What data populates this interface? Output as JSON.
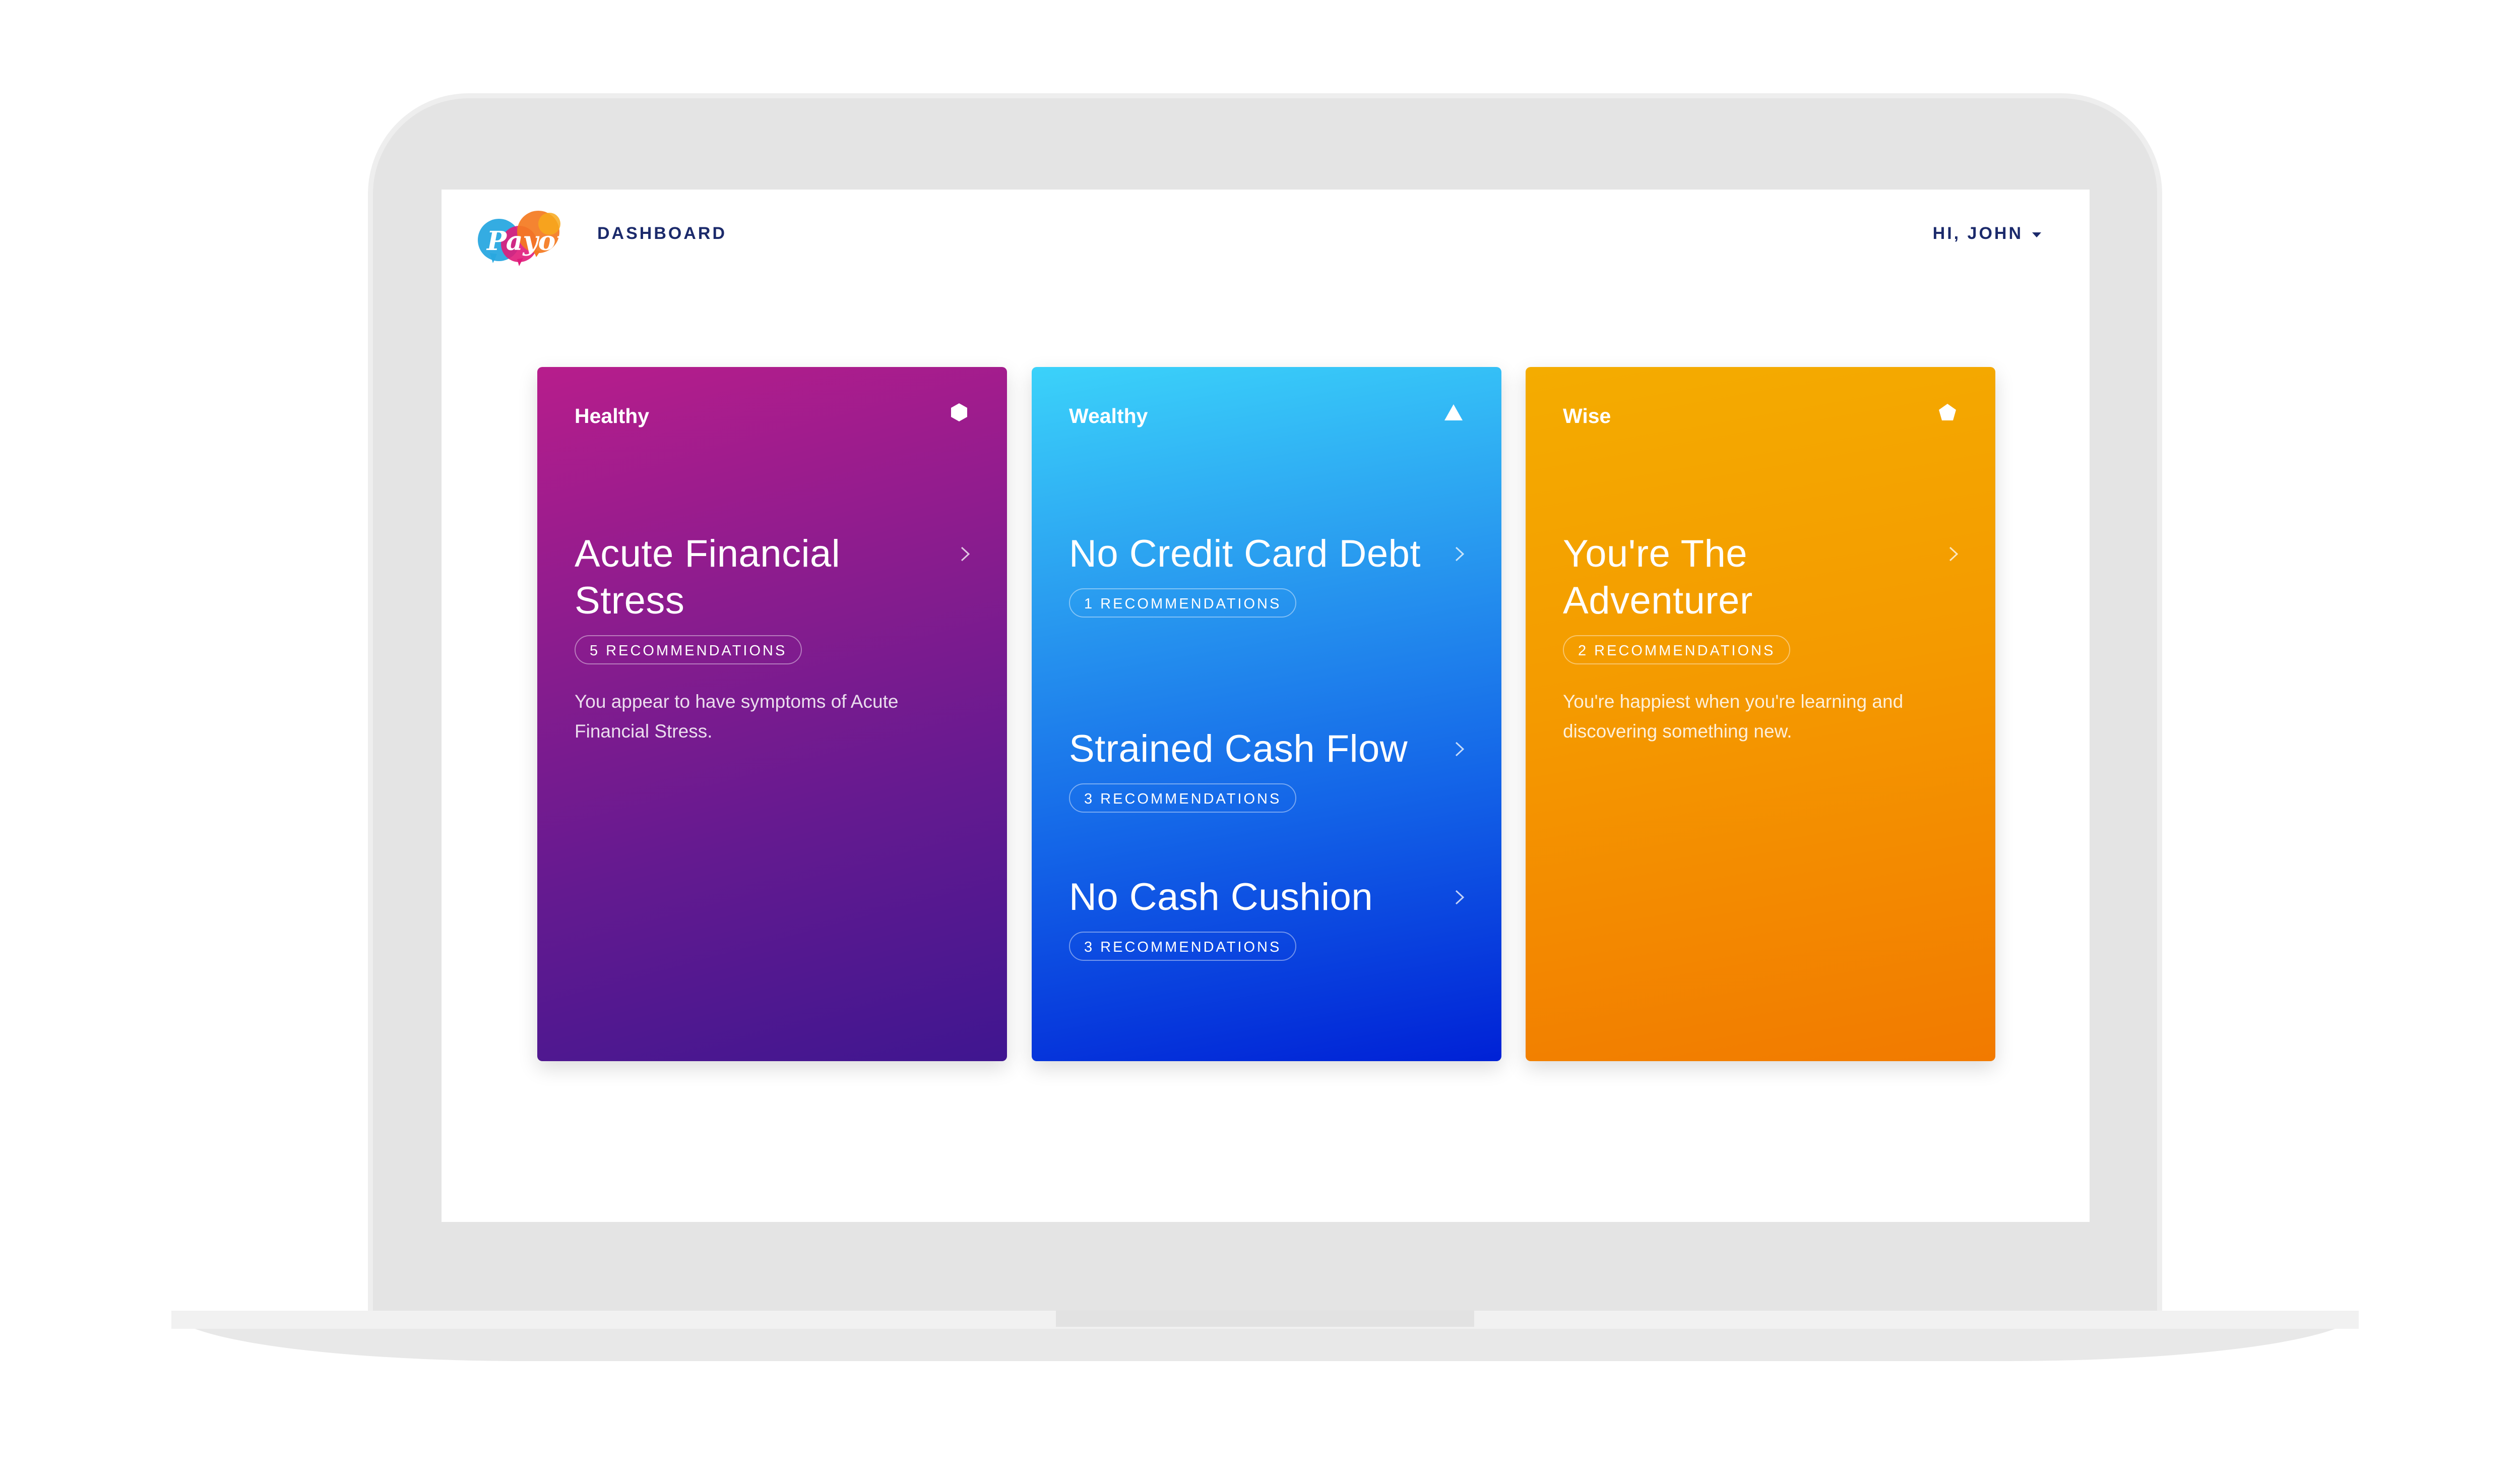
{
  "app": {
    "logo_alt": "Payoff",
    "logo_colors": [
      "#29a8e0",
      "#e01b7a",
      "#f47920",
      "#f7a81b"
    ]
  },
  "nav": {
    "dashboard_label": "DASHBOARD",
    "user_greeting": "HI, JOHN"
  },
  "cards": [
    {
      "label": "Healthy",
      "icon": "hexagon-icon",
      "colors": [
        "#b71d8c",
        "#3f1690"
      ],
      "items": [
        {
          "title": "Acute Financial Stress",
          "badge": "5 RECOMMENDATIONS",
          "description": "You appear to have symptoms of Acute Financial Stress."
        }
      ]
    },
    {
      "label": "Wealthy",
      "icon": "triangle-icon",
      "colors": [
        "#3bd2fa",
        "#0021d6"
      ],
      "items": [
        {
          "title": "No Credit Card Debt",
          "badge": "1 RECOMMENDATIONS"
        },
        {
          "title": "Strained Cash Flow",
          "badge": "3 RECOMMENDATIONS"
        },
        {
          "title": "No Cash Cushion",
          "badge": "3 RECOMMENDATIONS"
        }
      ]
    },
    {
      "label": "Wise",
      "icon": "pentagon-icon",
      "colors": [
        "#f4ac00",
        "#f27a00"
      ],
      "items": [
        {
          "title": "You're The Adventurer",
          "badge": "2 RECOMMENDATIONS",
          "description": "You're happiest when you're learning and discovering something new."
        }
      ]
    }
  ]
}
